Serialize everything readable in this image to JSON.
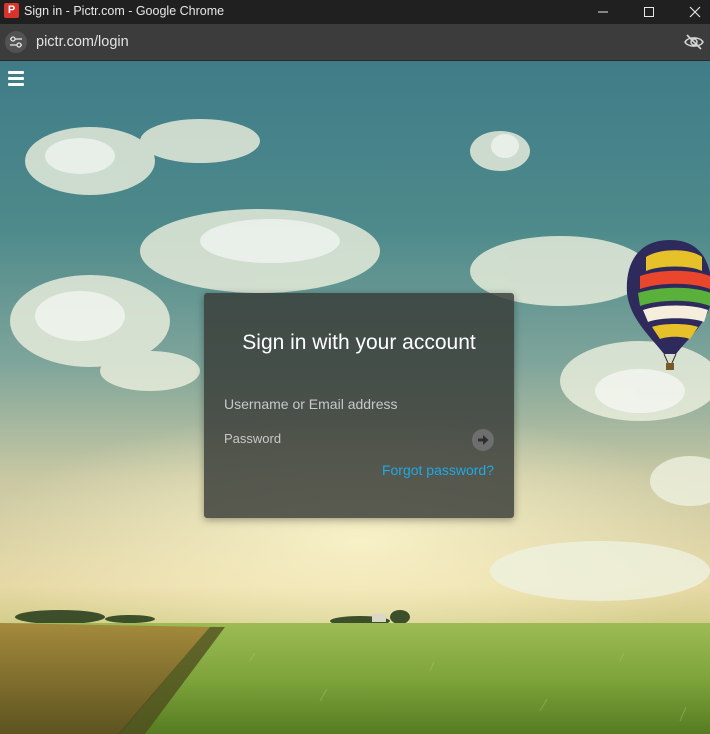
{
  "window": {
    "title": "Sign in - Pictr.com - Google Chrome",
    "favicon_letter": "P"
  },
  "addressbar": {
    "url": "pictr.com/login"
  },
  "icons": {
    "site_info": "tune-icon",
    "eye": "eye-off-icon",
    "menu": "hamburger-menu-icon",
    "submit": "arrow-right-icon",
    "balloon": "hot-air-balloon-illustration"
  },
  "login": {
    "heading": "Sign in with your account",
    "username_placeholder": "Username or Email address",
    "password_placeholder": "Password",
    "forgot_link": "Forgot password?"
  },
  "colors": {
    "link": "#1ea9e6",
    "card_bg": "rgba(55,58,55,0.82)",
    "titlebar_bg": "#202020",
    "addressbar_bg": "#3c3c3c"
  }
}
